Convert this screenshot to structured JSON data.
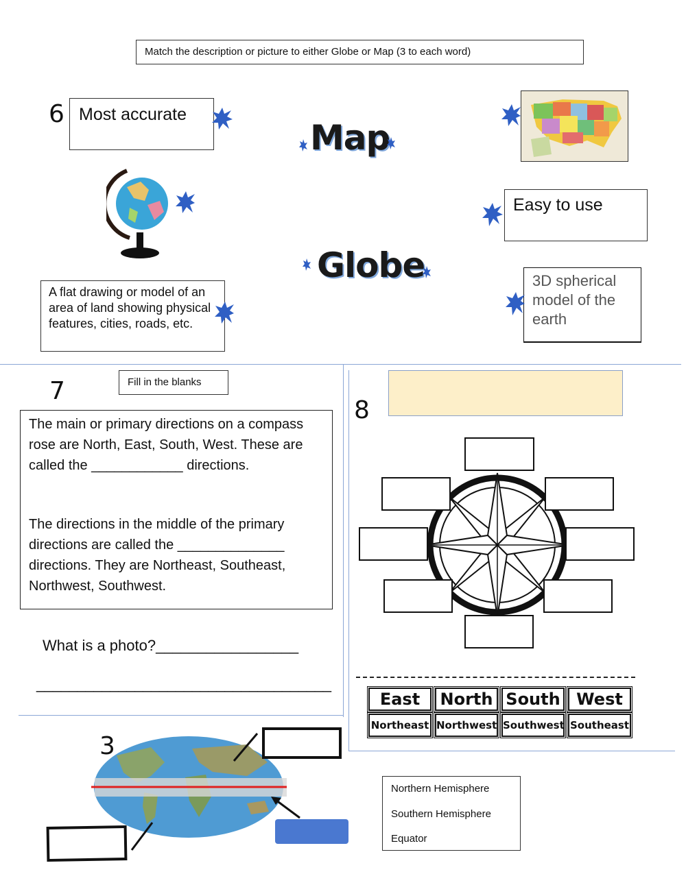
{
  "instruction": "Match the description or picture to either Globe or Map (3 to each word)",
  "q6": {
    "number": "6",
    "targets": [
      "Map",
      "Globe"
    ],
    "cards": {
      "most_accurate": "Most accurate",
      "easy_to_use": "Easy to use",
      "flat_drawing": "A flat drawing or model of an area of land showing physical features, cities, roads, etc.",
      "spherical": "3D spherical model of the earth"
    },
    "images": [
      "globe-picture",
      "us-map-picture"
    ]
  },
  "q7": {
    "number": "7",
    "label": "Fill in the blanks",
    "paragraph1": "The main or primary directions on a compass rose are North, East, South, West. These are called the ____________ directions.",
    "paragraph2": "The directions in the middle of the primary directions are called the ______________ directions. They are Northeast, Southeast, Northwest, Southwest.",
    "photo_question": "What is a photo?_________________",
    "photo_answer_line": "____________________________________"
  },
  "q8": {
    "number": "8",
    "primary_tiles": [
      "East",
      "North",
      "South",
      "West"
    ],
    "intermediate_tiles": [
      "Northeast",
      "Northwest",
      "Southwest",
      "Southeast"
    ],
    "header_color": "#fdefc9"
  },
  "q3": {
    "number": "3",
    "options": [
      "Northern Hemisphere",
      "Southern Hemisphere",
      "Equator"
    ],
    "equator_color": "#e02020",
    "answer_box_color": "#4a78d0"
  },
  "colors": {
    "star": "#2f5fc4",
    "divider": "#8aa6d6"
  }
}
